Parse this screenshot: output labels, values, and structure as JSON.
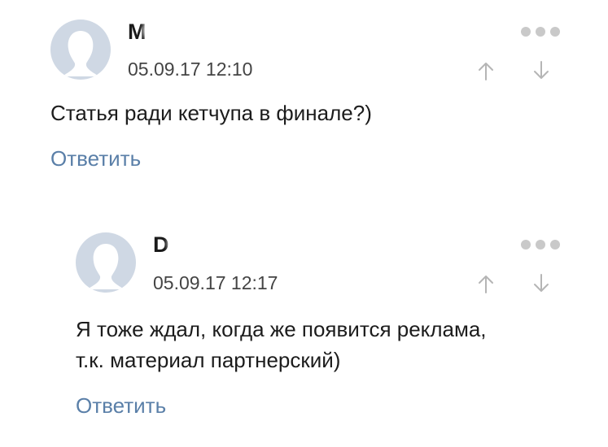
{
  "comments": [
    {
      "author": "М",
      "date": "05.09.17 12:10",
      "text": "Статья ради кетчупа в финале?)",
      "reply_label": "Ответить",
      "icons": {
        "avatar": "default-avatar-icon",
        "menu": "more-dots-icon",
        "up": "arrow-up-icon",
        "down": "arrow-down-icon"
      }
    },
    {
      "author": "D",
      "date": "05.09.17 12:17",
      "text_line1": "Я тоже ждал, когда же появится реклама,",
      "text_line2": "т.к. материал партнерский)",
      "reply_label": "Ответить",
      "icons": {
        "avatar": "default-avatar-icon",
        "menu": "more-dots-icon",
        "up": "arrow-up-icon",
        "down": "arrow-down-icon"
      }
    }
  ],
  "colors": {
    "link": "#5a7fa8",
    "avatar_bg": "#cfd8e4",
    "icon_gray": "#b5b5b5"
  }
}
